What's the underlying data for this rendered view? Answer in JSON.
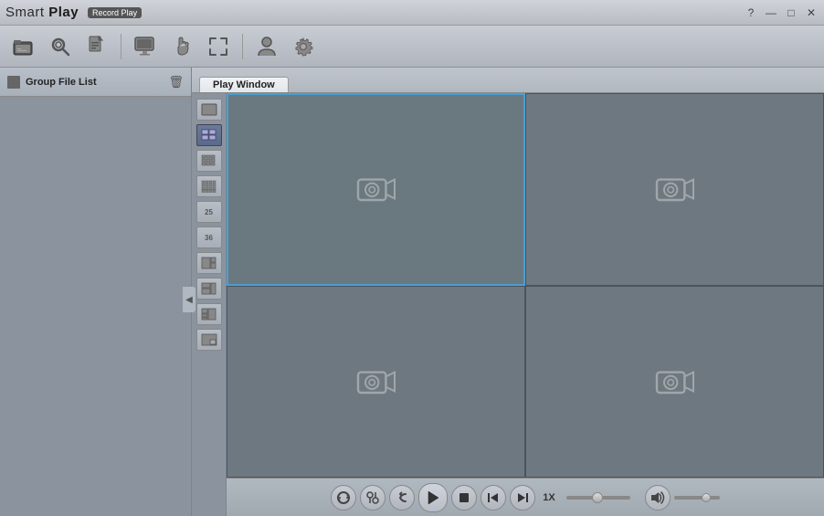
{
  "app": {
    "title_smart": "Smart",
    "title_play": "Play",
    "subtitle": "Record Play",
    "help": "?",
    "minimize": "—",
    "restore": "□",
    "close": "✕"
  },
  "toolbar": {
    "buttons": [
      {
        "name": "open-folder-btn",
        "label": "📁"
      },
      {
        "name": "search-btn",
        "label": "🔍"
      },
      {
        "name": "document-btn",
        "label": "📄"
      },
      {
        "name": "monitor-btn",
        "label": "🖥"
      },
      {
        "name": "hand-btn",
        "label": "✋"
      },
      {
        "name": "resize-btn",
        "label": "⤢"
      },
      {
        "name": "user-btn",
        "label": "👤"
      },
      {
        "name": "settings-btn",
        "label": "⚙"
      }
    ]
  },
  "sidebar": {
    "header_label": "Group File List"
  },
  "tabs": [
    {
      "id": "play-window",
      "label": "Play Window",
      "active": true
    }
  ],
  "layout_buttons": [
    {
      "id": "layout-1",
      "icon": "1x1",
      "active": false
    },
    {
      "id": "layout-4",
      "icon": "2x2",
      "active": true
    },
    {
      "id": "layout-9",
      "icon": "3x3",
      "active": false
    },
    {
      "id": "layout-16",
      "icon": "4x4",
      "active": false
    },
    {
      "id": "layout-25",
      "icon": "25",
      "active": false
    },
    {
      "id": "layout-36",
      "icon": "36",
      "active": false
    },
    {
      "id": "layout-custom1",
      "icon": "c1",
      "active": false
    },
    {
      "id": "layout-custom2",
      "icon": "c2",
      "active": false
    },
    {
      "id": "layout-custom3",
      "icon": "c3",
      "active": false
    },
    {
      "id": "layout-pip",
      "icon": "pip",
      "active": false
    }
  ],
  "video_cells": [
    {
      "id": "cell-1",
      "selected": true
    },
    {
      "id": "cell-2",
      "selected": false
    },
    {
      "id": "cell-3",
      "selected": false
    },
    {
      "id": "cell-4",
      "selected": false
    }
  ],
  "controls": {
    "sync_label": "↺",
    "zoom_label": "⊕",
    "rewind_label": "↩",
    "play_label": "▶",
    "stop_label": "■",
    "prev_frame_label": "◀|",
    "next_frame_label": "|▶",
    "speed_label": "1X",
    "volume_icon": "🔊"
  }
}
